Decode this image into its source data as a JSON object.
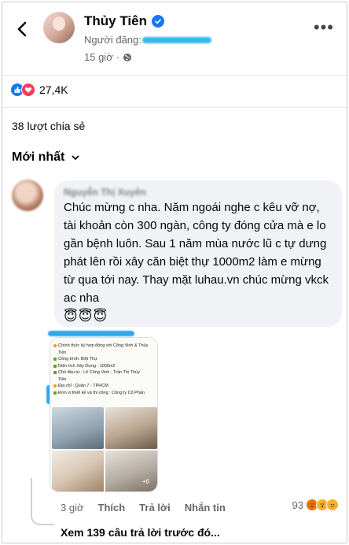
{
  "post": {
    "author_name": "Thủy Tiên",
    "poster_label": "Người đăng:",
    "time": "15 giờ",
    "reaction_count": "27,4K",
    "shares": "38 lượt chia sẻ"
  },
  "comments_header": {
    "sort_label": "Mới nhất"
  },
  "comment": {
    "author": "Nguyễn Thị Xuyên",
    "text": "Chúc mừng c nha. Năm ngoái nghe c kêu vỡ nợ, tài khoản còn 300 ngàn, công ty đóng cửa mà e lo gần bệnh luôn. Sau 1 năm mùa nước lũ c tự dưng phát lên rồi xây căn biệt thự 1000m2 làm e mừng từ qua tới nay. Thay mặt luhau.vn chúc mừng vkck ac nha",
    "emojis": "😇😇😇",
    "image_lines": [
      "Chính thức ký hợp đồng với Công Vinh & Thủy",
      "Tiên",
      "Công trình: Biệt Thự",
      "Diện tích Xây Dựng : 1000m2",
      "Chủ đầu tư : Lê Công Vinh - Trần Thị Thủy",
      "Tiên",
      "Địa chỉ : Quận 7 - TPHCM",
      "Đơn vị thiết kế và thi công : Công ty Cổ Phần"
    ],
    "image_more": "+6",
    "time": "3 giờ",
    "like_label": "Thích",
    "reply_label": "Trả lời",
    "message_label": "Nhắn tin",
    "reaction_count": "93"
  },
  "replies": {
    "view_previous": "Xem 139 câu trả lời trước đó..."
  },
  "icons": {
    "back": "chevron-left-icon",
    "verified": "verified-badge-icon",
    "globe": "globe-icon",
    "more": "more-dots-icon",
    "dropdown": "chevron-down-icon"
  },
  "colors": {
    "facebook_blue": "#1877f2",
    "love_red": "#f33e58",
    "bubble_bg": "#f0f2f5",
    "secondary_text": "#65676b"
  }
}
